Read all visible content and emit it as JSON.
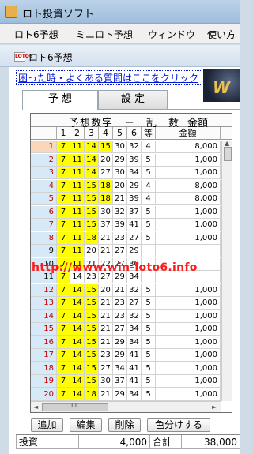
{
  "window": {
    "title": "ロト投資ソフト"
  },
  "menu": [
    "ロト6予想",
    "ミニロト予想",
    "ウィンドウ",
    "使い方"
  ],
  "document": {
    "title": "ロト6予想",
    "icon": "loto6-doc-icon",
    "icon_label": "LOTO6"
  },
  "help_link": "困った時・よくある質問はここをクリック",
  "banner_text": "W",
  "tabs": [
    {
      "label": "予 想",
      "active": true
    },
    {
      "label": "設 定",
      "active": false
    }
  ],
  "grid": {
    "header_top": "予想数字　－　乱　数",
    "header_top_right": "金額",
    "columns": [
      "1",
      "2",
      "3",
      "4",
      "5",
      "6",
      "等",
      "金額"
    ],
    "rows": [
      {
        "no": "1",
        "nums": [
          "7",
          "11",
          "14",
          "15",
          "30",
          "32"
        ],
        "grade": "4",
        "amount": "8,000",
        "yellow": 4
      },
      {
        "no": "2",
        "nums": [
          "7",
          "11",
          "14",
          "20",
          "29",
          "39"
        ],
        "grade": "5",
        "amount": "1,000",
        "yellow": 3
      },
      {
        "no": "3",
        "nums": [
          "7",
          "11",
          "14",
          "27",
          "30",
          "34"
        ],
        "grade": "5",
        "amount": "1,000",
        "yellow": 3
      },
      {
        "no": "4",
        "nums": [
          "7",
          "11",
          "15",
          "18",
          "20",
          "29"
        ],
        "grade": "4",
        "amount": "8,000",
        "yellow": 4
      },
      {
        "no": "5",
        "nums": [
          "7",
          "11",
          "15",
          "18",
          "21",
          "39"
        ],
        "grade": "4",
        "amount": "8,000",
        "yellow": 4
      },
      {
        "no": "6",
        "nums": [
          "7",
          "11",
          "15",
          "30",
          "32",
          "37"
        ],
        "grade": "5",
        "amount": "1,000",
        "yellow": 3
      },
      {
        "no": "7",
        "nums": [
          "7",
          "11",
          "15",
          "37",
          "39",
          "41"
        ],
        "grade": "5",
        "amount": "1,000",
        "yellow": 3
      },
      {
        "no": "8",
        "nums": [
          "7",
          "11",
          "18",
          "21",
          "23",
          "27"
        ],
        "grade": "5",
        "amount": "1,000",
        "yellow": 3
      },
      {
        "no": "9",
        "nums": [
          "7",
          "11",
          "20",
          "21",
          "27",
          "29"
        ],
        "grade": "",
        "amount": "",
        "yellow": 2
      },
      {
        "no": "10",
        "nums": [
          "7",
          "11",
          "21",
          "22",
          "27",
          "30"
        ],
        "grade": "",
        "amount": "",
        "yellow": 2
      },
      {
        "no": "11",
        "nums": [
          "7",
          "14",
          "23",
          "27",
          "29",
          "34"
        ],
        "grade": "",
        "amount": "",
        "yellow": 1
      },
      {
        "no": "12",
        "nums": [
          "7",
          "14",
          "15",
          "20",
          "21",
          "32"
        ],
        "grade": "5",
        "amount": "1,000",
        "yellow": 3
      },
      {
        "no": "13",
        "nums": [
          "7",
          "14",
          "15",
          "21",
          "23",
          "27"
        ],
        "grade": "5",
        "amount": "1,000",
        "yellow": 3
      },
      {
        "no": "14",
        "nums": [
          "7",
          "14",
          "15",
          "21",
          "23",
          "32"
        ],
        "grade": "5",
        "amount": "1,000",
        "yellow": 3
      },
      {
        "no": "15",
        "nums": [
          "7",
          "14",
          "15",
          "21",
          "27",
          "34"
        ],
        "grade": "5",
        "amount": "1,000",
        "yellow": 3
      },
      {
        "no": "16",
        "nums": [
          "7",
          "14",
          "15",
          "21",
          "29",
          "34"
        ],
        "grade": "5",
        "amount": "1,000",
        "yellow": 3
      },
      {
        "no": "17",
        "nums": [
          "7",
          "14",
          "15",
          "23",
          "29",
          "41"
        ],
        "grade": "5",
        "amount": "1,000",
        "yellow": 3
      },
      {
        "no": "18",
        "nums": [
          "7",
          "14",
          "15",
          "27",
          "34",
          "41"
        ],
        "grade": "5",
        "amount": "1,000",
        "yellow": 3
      },
      {
        "no": "19",
        "nums": [
          "7",
          "14",
          "15",
          "30",
          "37",
          "41"
        ],
        "grade": "5",
        "amount": "1,000",
        "yellow": 3
      },
      {
        "no": "20",
        "nums": [
          "7",
          "14",
          "18",
          "21",
          "29",
          "34"
        ],
        "grade": "5",
        "amount": "1,000",
        "yellow": 3
      }
    ],
    "scroll_arrow_left": "◄",
    "scroll_arrow_right": "►",
    "scroll_arrow_up": "▲",
    "scroll_thumb_grip": "III"
  },
  "watermark": "http://www.win-loto6.info",
  "buttons": [
    "追加",
    "編集",
    "削除",
    "色分けする"
  ],
  "summary": {
    "invest_label": "投資",
    "invest_value": "4,000",
    "total_label": "合計",
    "total_value": "38,000"
  },
  "colors": {
    "highlight": "#ffff00",
    "row_header": "#d7e9f6",
    "hit_marker": "#e15f5a",
    "link": "#0018d6"
  }
}
